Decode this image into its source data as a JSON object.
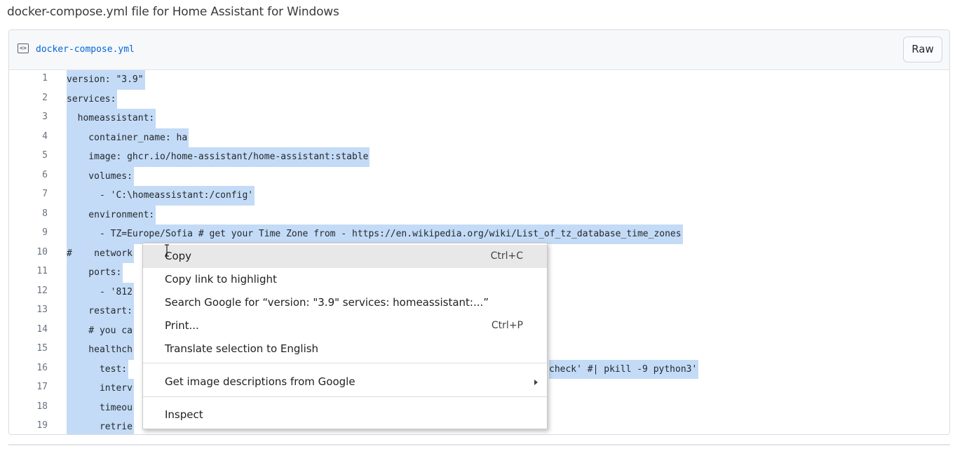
{
  "page": {
    "description": "docker-compose.yml file for Home Assistant for Windows"
  },
  "file": {
    "icon": "code-file-icon",
    "icon_glyph": "<>",
    "name": "docker-compose.yml",
    "raw_label": "Raw"
  },
  "code_lines": [
    {
      "n": "1",
      "text": "version: \"3.9\""
    },
    {
      "n": "2",
      "text": "services:"
    },
    {
      "n": "3",
      "text": "  homeassistant:"
    },
    {
      "n": "4",
      "text": "    container_name: ha"
    },
    {
      "n": "5",
      "text": "    image: ghcr.io/home-assistant/home-assistant:stable"
    },
    {
      "n": "6",
      "text": "    volumes:"
    },
    {
      "n": "7",
      "text": "      - 'C:\\homeassistant:/config'"
    },
    {
      "n": "8",
      "text": "    environment:"
    },
    {
      "n": "9",
      "text": "      - TZ=Europe/Sofia # get your Time Zone from - https://en.wikipedia.org/wiki/List_of_tz_database_time_zones"
    },
    {
      "n": "10",
      "text": "#    network"
    },
    {
      "n": "11",
      "text": "    ports:"
    },
    {
      "n": "12",
      "text": "      - '812"
    },
    {
      "n": "13",
      "text": "    restart:"
    },
    {
      "n": "14",
      "text": "    # you ca"
    },
    {
      "n": "15",
      "text": "    healthch"
    },
    {
      "n": "16",
      "text": "      test:"
    },
    {
      "n": "17",
      "text": "      interv"
    },
    {
      "n": "18",
      "text": "      timeou"
    },
    {
      "n": "19",
      "text": "      retrie"
    }
  ],
  "visible_tail_line16": "check' #| pkill -9 python3'",
  "context_menu": {
    "items": [
      {
        "label": "Copy",
        "shortcut": "Ctrl+C"
      },
      {
        "label": "Copy link to highlight",
        "shortcut": ""
      },
      {
        "label": "Search Google for “version: \"3.9\" services:   homeassistant:...”",
        "shortcut": ""
      },
      {
        "label": "Print...",
        "shortcut": "Ctrl+P"
      },
      {
        "label": "Translate selection to English",
        "shortcut": ""
      },
      {
        "label": "Get image descriptions from Google",
        "shortcut": ""
      },
      {
        "label": "Inspect",
        "shortcut": ""
      }
    ]
  },
  "colors": {
    "selection": "#c3dbf6",
    "link": "#0366d6",
    "menu_hover": "#e8e8e8"
  }
}
